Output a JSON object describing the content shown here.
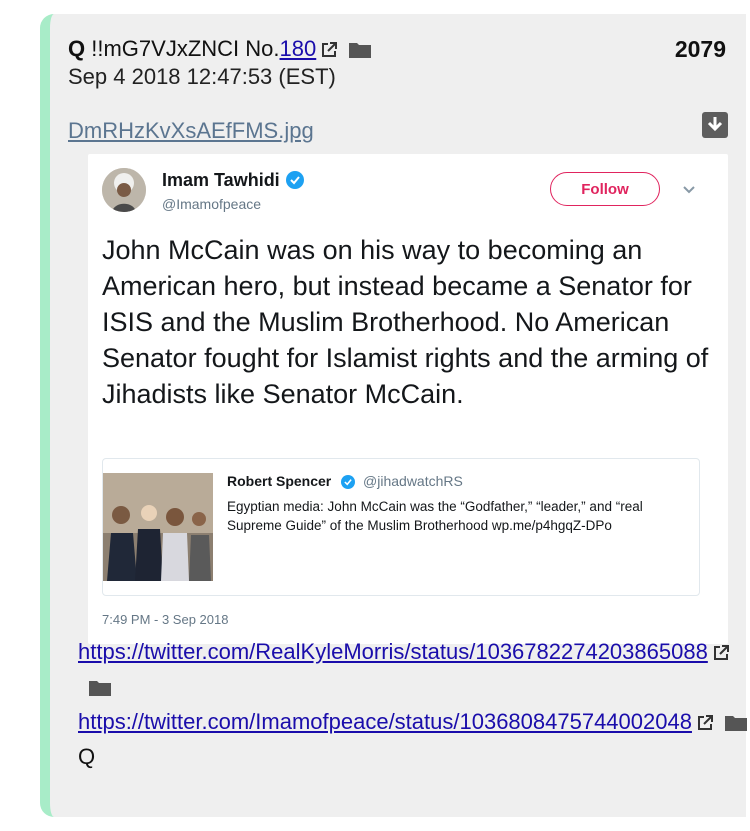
{
  "post": {
    "author": "Q",
    "tripcode": "!!mG7VJxZNCI",
    "no_label": "No.",
    "no": "180",
    "post_number": "2079",
    "date": "Sep 4 2018 12:47:53 (EST)",
    "filename": "DmRHzKvXsAEfFMS.jpg",
    "links": [
      "https://twitter.com/RealKyleMorris/status/1036782274203865088",
      "https://twitter.com/Imamofpeace/status/1036808475744002048"
    ],
    "signature": "Q"
  },
  "tweet": {
    "name": "Imam Tawhidi",
    "handle": "@Imamofpeace",
    "follow_label": "Follow",
    "text": "John McCain was on his way to becoming an American hero, but instead became a Senator for ISIS and the Muslim Brotherhood. No American Senator fought for Islamist rights and the arming of Jihadists like Senator McCain.",
    "time": "7:49 PM - 3 Sep 2018",
    "quoted": {
      "name": "Robert Spencer",
      "handle": "@jihadwatchRS",
      "text": "Egyptian media: John McCain was the “Godfather,” “leader,” and “real Supreme Guide” of the Muslim Brotherhood wp.me/p4hgqZ-DPo"
    }
  },
  "colors": {
    "accent_border": "#a8ecc8",
    "link": "#1a0dab",
    "follow": "#e0245e",
    "verified": "#1da1f2"
  },
  "icons": [
    "external-link-icon",
    "folder-icon",
    "download-icon",
    "verified-icon",
    "chevron-down-icon"
  ]
}
